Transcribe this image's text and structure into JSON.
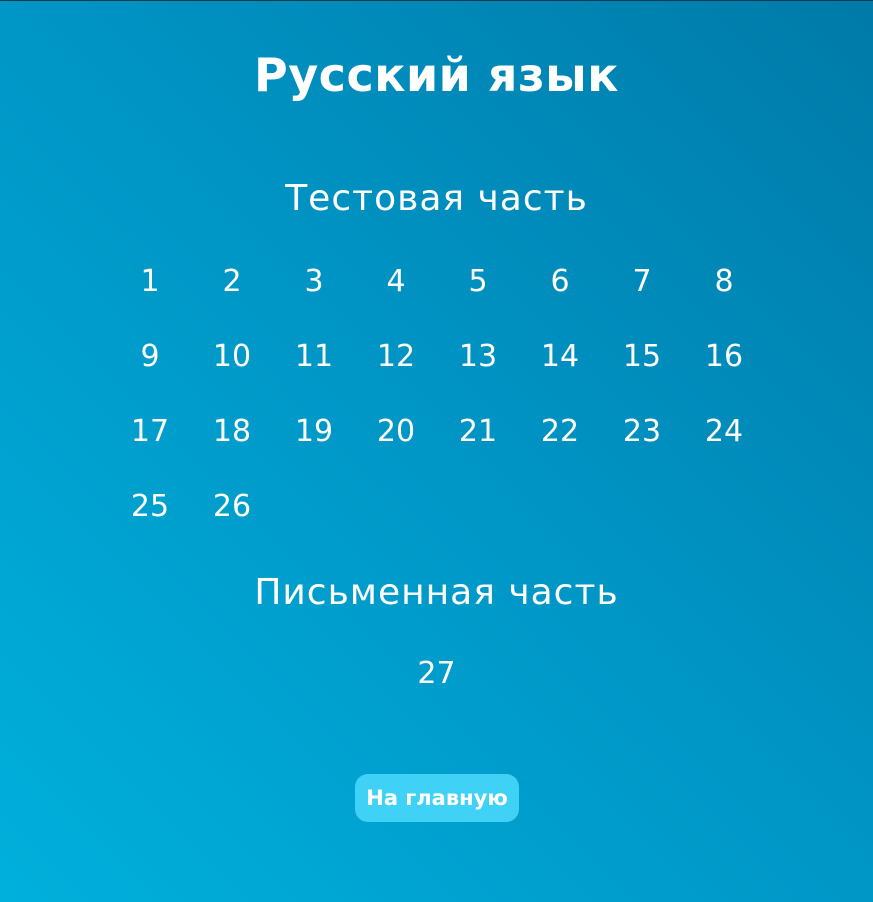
{
  "page": {
    "title": "Русский язык"
  },
  "test_section": {
    "heading": "Тестовая часть",
    "tasks": [
      "1",
      "2",
      "3",
      "4",
      "5",
      "6",
      "7",
      "8",
      "9",
      "10",
      "11",
      "12",
      "13",
      "14",
      "15",
      "16",
      "17",
      "18",
      "19",
      "20",
      "21",
      "22",
      "23",
      "24",
      "25",
      "26"
    ]
  },
  "written_section": {
    "heading": "Письменная часть",
    "tasks": [
      "27"
    ]
  },
  "home_button": {
    "label": "На главную"
  },
  "colors": {
    "background_start": "#00b0dc",
    "background_end": "#007aa8",
    "button": "#3fd2f6",
    "text": "#ffffff"
  }
}
